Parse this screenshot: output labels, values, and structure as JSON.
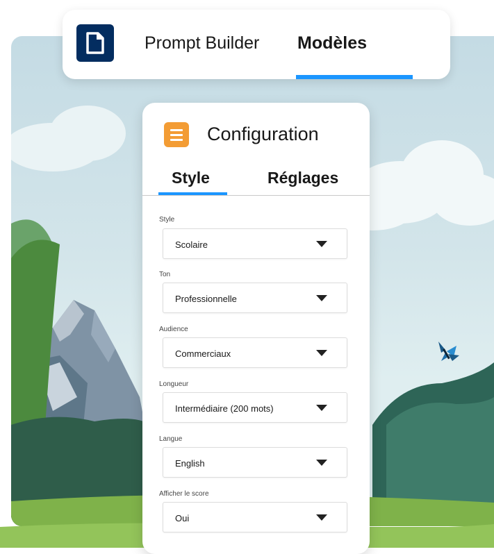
{
  "header": {
    "tabs": [
      {
        "label": "Prompt Builder",
        "active": false
      },
      {
        "label": "Modèles",
        "active": true
      }
    ],
    "app_icon": "document-icon"
  },
  "config": {
    "title": "Configuration",
    "icon": "list-icon",
    "tabs": [
      {
        "label": "Style",
        "active": true
      },
      {
        "label": "Réglages",
        "active": false
      }
    ],
    "fields": [
      {
        "label": "Style",
        "value": "Scolaire"
      },
      {
        "label": "Ton",
        "value": "Professionnelle"
      },
      {
        "label": "Audience",
        "value": "Commerciaux"
      },
      {
        "label": "Longueur",
        "value": "Intermédiaire (200 mots)"
      },
      {
        "label": "Langue",
        "value": "English"
      },
      {
        "label": "Afficher le score",
        "value": "Oui"
      }
    ]
  },
  "colors": {
    "accent": "#1b96ff",
    "app_icon_bg": "#032d60",
    "config_icon_bg": "#f39c34"
  }
}
